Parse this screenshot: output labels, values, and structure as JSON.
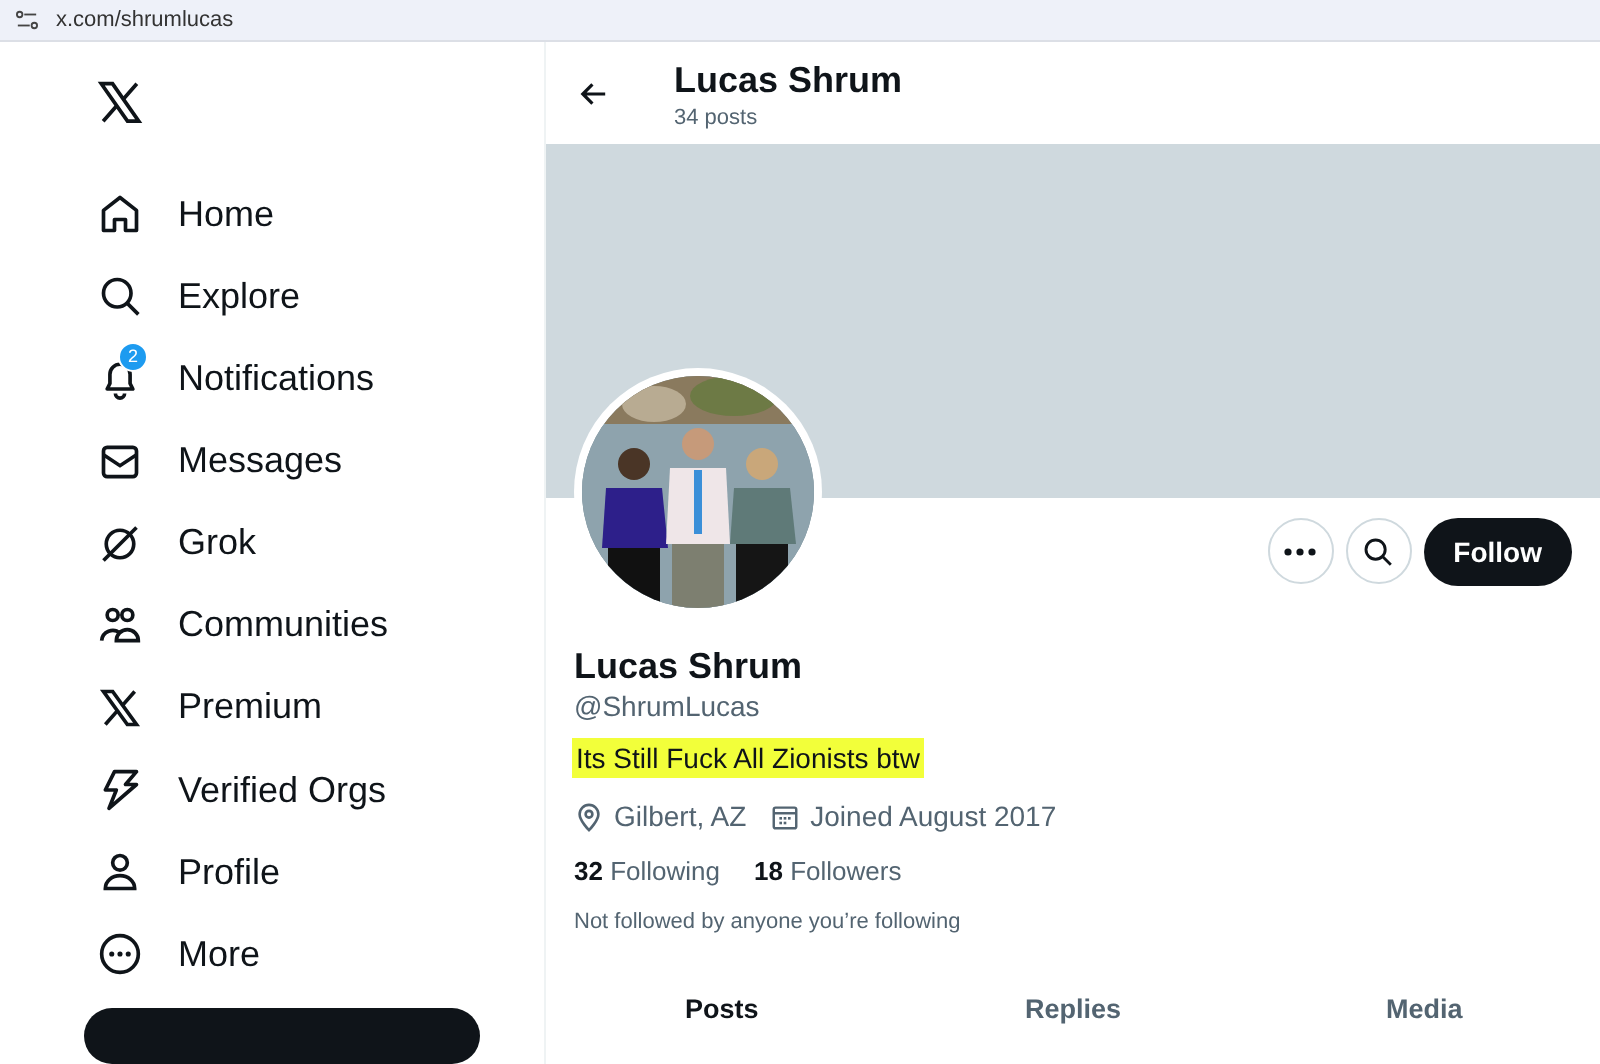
{
  "address_bar": {
    "url": "x.com/shrumlucas"
  },
  "sidebar": {
    "items": [
      {
        "label": "Home",
        "selected": false
      },
      {
        "label": "Explore",
        "selected": false
      },
      {
        "label": "Notifications",
        "selected": false,
        "badge": "2"
      },
      {
        "label": "Messages",
        "selected": false
      },
      {
        "label": "Grok",
        "selected": false
      },
      {
        "label": "Communities",
        "selected": false
      },
      {
        "label": "Premium",
        "selected": false
      },
      {
        "label": "Verified Orgs",
        "selected": false
      },
      {
        "label": "Profile",
        "selected": false
      },
      {
        "label": "More",
        "selected": false
      }
    ]
  },
  "header": {
    "title": "Lucas Shrum",
    "subtitle": "34 posts"
  },
  "profile": {
    "name": "Lucas Shrum",
    "handle": "@ShrumLucas",
    "bio": "Its Still Fuck All Zionists btw",
    "bio_highlighted": true,
    "location": "Gilbert, AZ",
    "joined": "Joined August 2017",
    "following_count": "32",
    "following_label": "Following",
    "followers_count": "18",
    "followers_label": "Followers",
    "note": "Not followed by anyone you’re following",
    "follow_button": "Follow"
  },
  "tabs": [
    {
      "label": "Posts",
      "selected": true
    },
    {
      "label": "Replies",
      "selected": false
    },
    {
      "label": "Media",
      "selected": false
    }
  ]
}
